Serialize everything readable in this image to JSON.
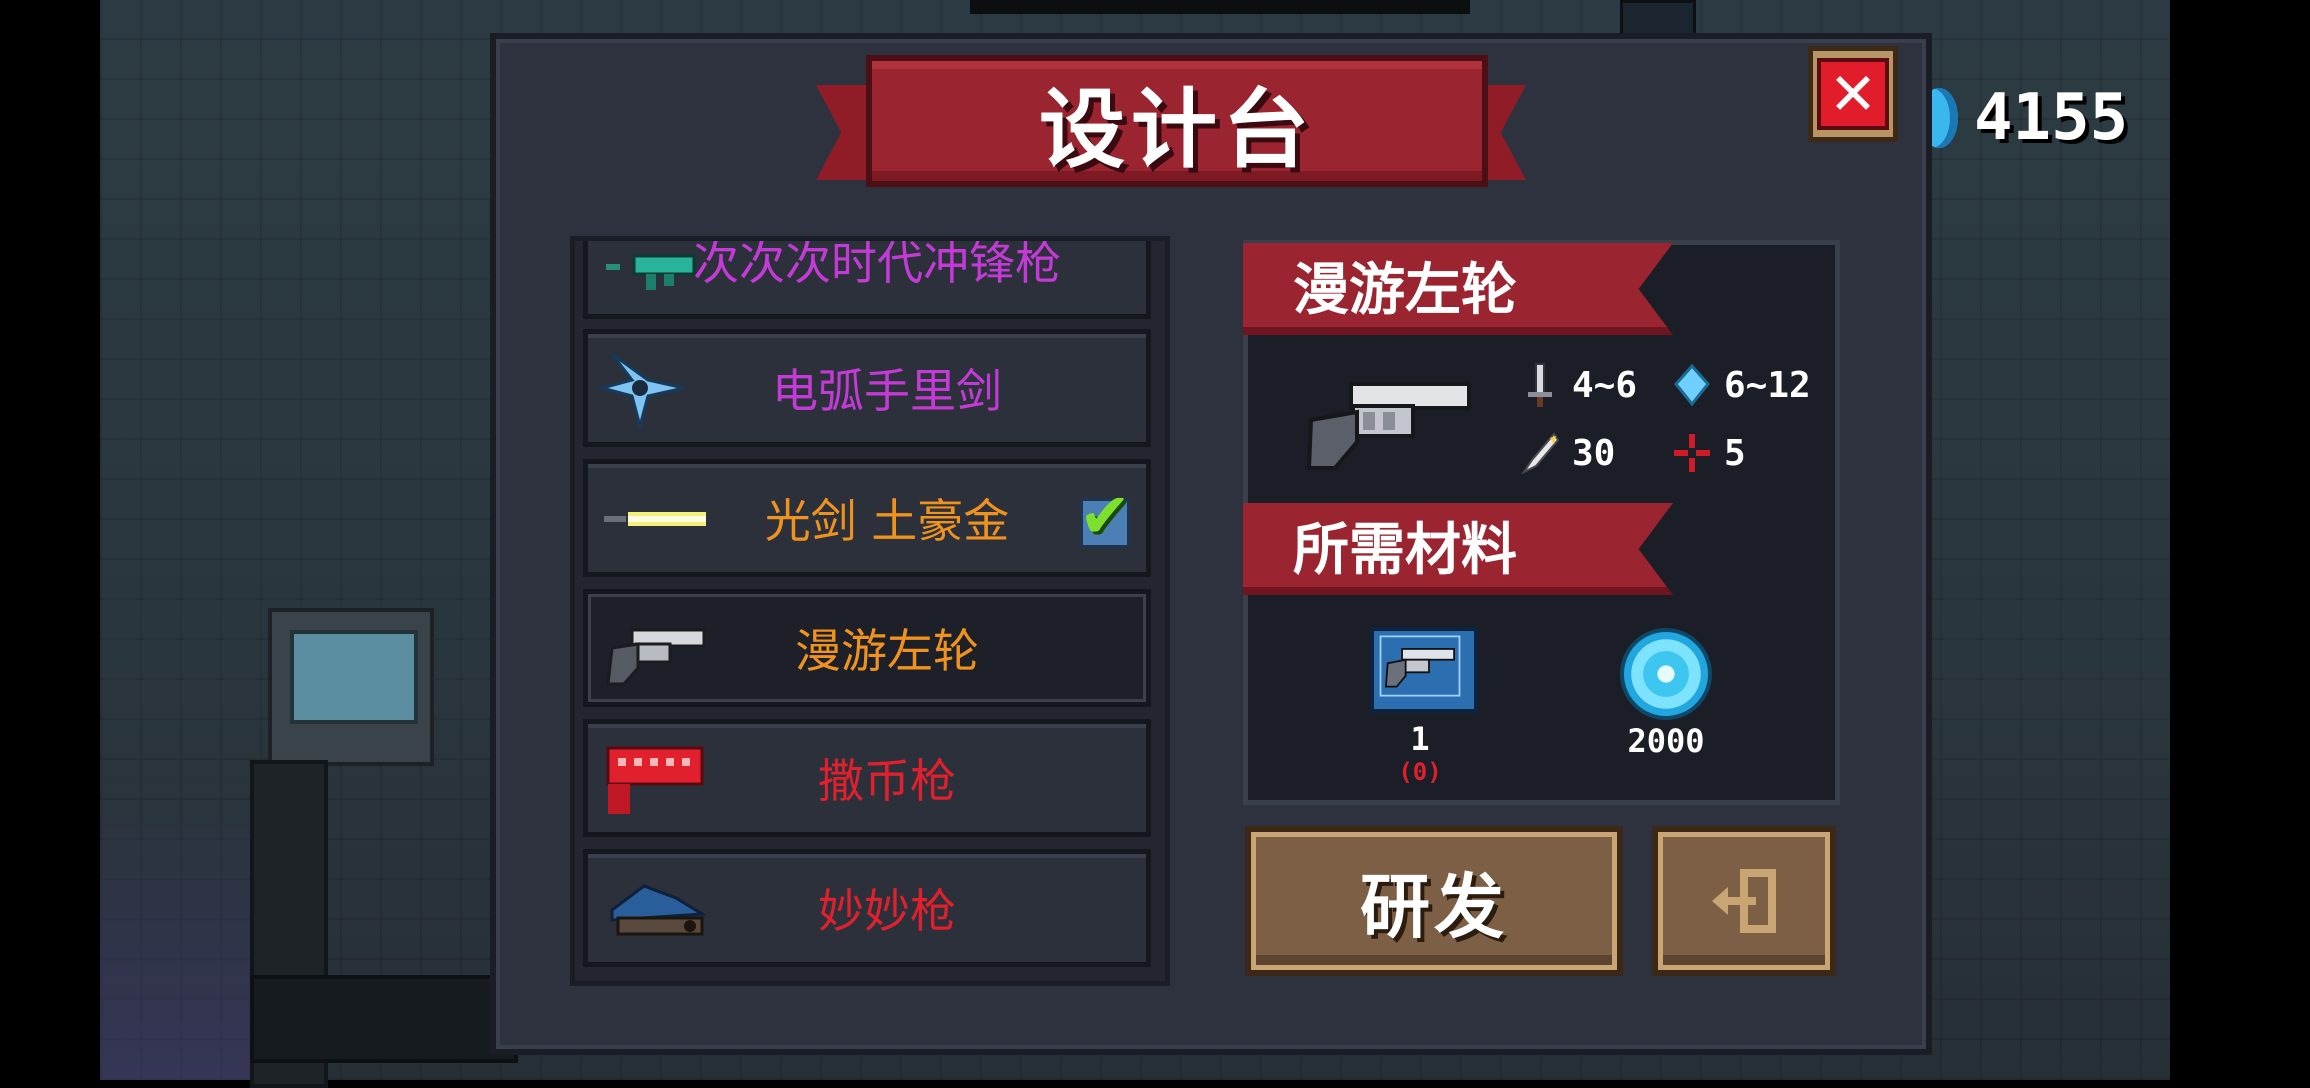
{
  "hud": {
    "currency_icon": "blue-gem-icon",
    "currency_value": "4155"
  },
  "dialog": {
    "title": "设计台",
    "close_icon": "close-x-icon"
  },
  "weapon_list": [
    {
      "name": "次次次时代冲锋枪",
      "color": "#c43ad6",
      "icon": "smg-icon",
      "selected": false,
      "checked": false
    },
    {
      "name": "电弧手里剑",
      "color": "#c43ad6",
      "icon": "shuriken-icon",
      "selected": false,
      "checked": false
    },
    {
      "name": "光剑 土豪金",
      "color": "#f0921e",
      "icon": "lightsaber-icon",
      "selected": false,
      "checked": true
    },
    {
      "name": "漫游左轮",
      "color": "#f0921e",
      "icon": "revolver-icon",
      "selected": true,
      "checked": false
    },
    {
      "name": "撒币枪",
      "color": "#e0202c",
      "icon": "coin-gun-icon",
      "selected": false,
      "checked": false
    },
    {
      "name": "妙妙枪",
      "color": "#e0202c",
      "icon": "cat-gun-icon",
      "selected": false,
      "checked": false
    }
  ],
  "detail": {
    "weapon_name": "漫游左轮",
    "stats": {
      "damage": "4~6",
      "energy": "6~12",
      "crit": "30",
      "accuracy": "5"
    },
    "materials_title": "所需材料",
    "materials": [
      {
        "icon": "revolver-blueprint-icon",
        "count": "1",
        "have": "(0)"
      },
      {
        "icon": "gem-icon",
        "count": "2000"
      }
    ]
  },
  "actions": {
    "develop_label": "研发",
    "exit_icon": "exit-icon"
  },
  "colors": {
    "ribbon_red": "#9a2430",
    "button_brown": "#7d5f45",
    "panel_dark": "#2e323f"
  }
}
